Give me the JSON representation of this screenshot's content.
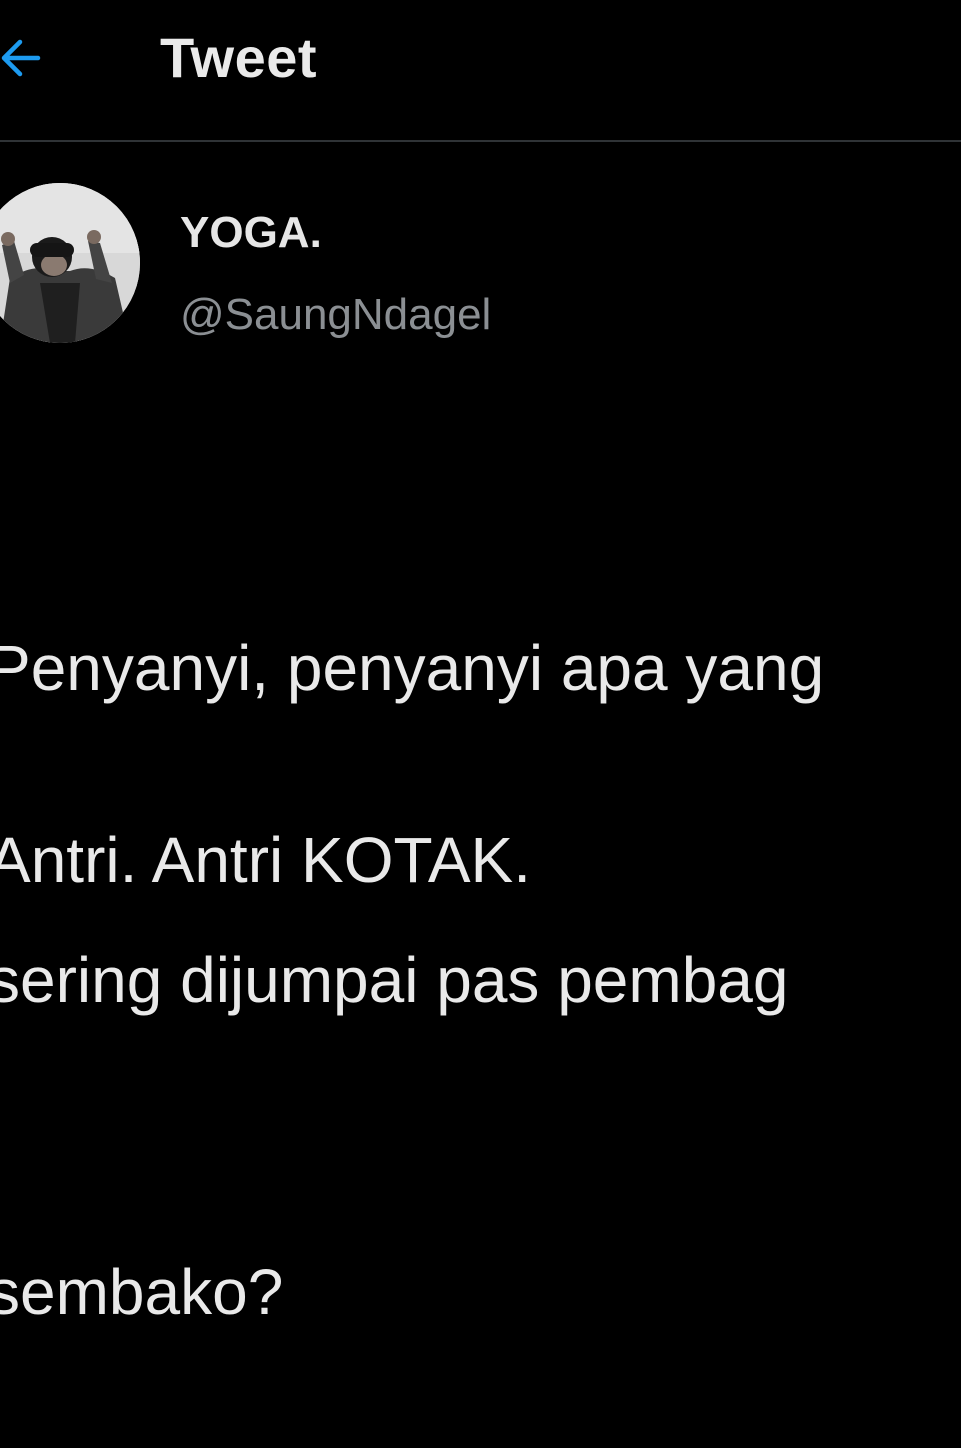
{
  "header": {
    "back_icon": "arrow-left-icon",
    "title": "Tweet",
    "accent_color": "#1d9bf0"
  },
  "author": {
    "display_name": "YOGA.",
    "handle": "@SaungNdagel",
    "avatar_icon": "profile-photo"
  },
  "tweet": {
    "lines": [
      "Penyanyi, penyanyi apa yang",
      "sering dijumpai pas pembag",
      "sembako?"
    ],
    "punchline": "Antri. Antri KOTAK."
  }
}
